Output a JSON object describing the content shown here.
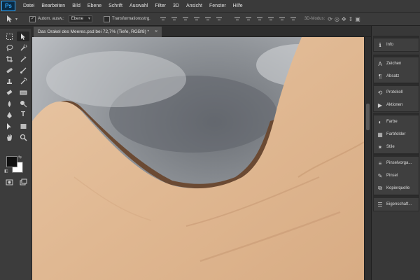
{
  "app": {
    "logo": "Ps"
  },
  "menu": [
    "Datei",
    "Bearbeiten",
    "Bild",
    "Ebene",
    "Schrift",
    "Auswahl",
    "Filter",
    "3D",
    "Ansicht",
    "Fenster",
    "Hilfe"
  ],
  "options": {
    "auto_select_label": "Autom. ausw.:",
    "auto_select_checked": "✓",
    "auto_select_value": "Ebene",
    "transform_label": "Transformationsstrg.",
    "mode_3d_label": "3D-Modus:"
  },
  "document": {
    "tab_title": "Das Orakel des Meeres.psd bei 72,7% (Tiefe, RGB/8) *",
    "close": "×"
  },
  "panels": {
    "groups": [
      {
        "items": [
          {
            "icon": "info-icon",
            "glyph": "ℹ",
            "label": "Info"
          }
        ]
      },
      {
        "items": [
          {
            "icon": "character-icon",
            "glyph": "A",
            "label": "Zeichen"
          },
          {
            "icon": "paragraph-icon",
            "glyph": "¶",
            "label": "Absatz"
          }
        ]
      },
      {
        "items": [
          {
            "icon": "history-icon",
            "glyph": "⟲",
            "label": "Protokoll"
          },
          {
            "icon": "actions-icon",
            "glyph": "▶",
            "label": "Aktionen"
          }
        ]
      },
      {
        "items": [
          {
            "icon": "color-icon",
            "glyph": "◐",
            "label": "Farbe"
          },
          {
            "icon": "swatches-icon",
            "glyph": "▦",
            "label": "Farbfelder"
          },
          {
            "icon": "styles-icon",
            "glyph": "✶",
            "label": "Stile"
          }
        ]
      },
      {
        "items": [
          {
            "icon": "brush-presets-icon",
            "glyph": "≡",
            "label": "Pinselvorga..."
          },
          {
            "icon": "brush-icon",
            "glyph": "✎",
            "label": "Pinsel"
          },
          {
            "icon": "clone-source-icon",
            "glyph": "⧉",
            "label": "Kopierquelle"
          }
        ]
      },
      {
        "items": [
          {
            "icon": "properties-icon",
            "glyph": "☰",
            "label": "Eigenschaft..."
          }
        ]
      }
    ]
  },
  "colors": {
    "foreground": "#111111",
    "background": "#ffffff"
  }
}
